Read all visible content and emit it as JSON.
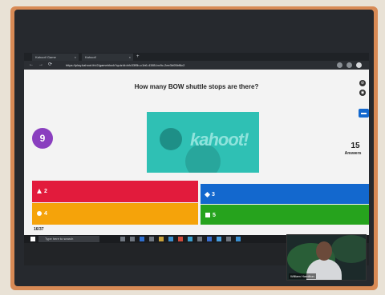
{
  "browser": {
    "tabs": [
      {
        "label": "Kahoot! Game"
      },
      {
        "label": "Kahoot!"
      }
    ],
    "new_tab_label": "+",
    "url": "https://play.kahoot.it/v2/gameblock?quizId=bfc33f5b-c1b6-4385-bc9c-2ee3b05bf6c2",
    "nav": {
      "back": "←",
      "forward": "→",
      "reload": "⟳"
    }
  },
  "quiz": {
    "question": "How many BOW shuttle stops are there?",
    "timer": "9",
    "media_logo": "kahoot!",
    "answers_count": "15",
    "answers_label": "Answers",
    "options": [
      {
        "label": "2",
        "shape": "triangle",
        "color": "#e21b3c"
      },
      {
        "label": "3",
        "shape": "diamond",
        "color": "#1368ce"
      },
      {
        "label": "4",
        "shape": "circle",
        "color": "#f5a30a"
      },
      {
        "label": "5",
        "shape": "square",
        "color": "#26a31d"
      }
    ],
    "progress": "16/37"
  },
  "taskbar": {
    "search_placeholder": "Type here to search"
  },
  "webcam": {
    "name_label": "William Hamilton"
  }
}
